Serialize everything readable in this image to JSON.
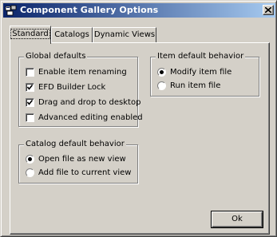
{
  "window": {
    "title": "Component Gallery Options",
    "close_label": "×"
  },
  "tabs": [
    {
      "label": "Standard",
      "active": true
    },
    {
      "label": "Catalogs",
      "active": false
    },
    {
      "label": "Dynamic Views",
      "active": false
    }
  ],
  "global_defaults": {
    "title": "Global defaults",
    "options": [
      {
        "label": "Enable item renaming",
        "checked": false
      },
      {
        "label": "EFD Builder Lock",
        "checked": true
      },
      {
        "label": "Drag and drop to desktop",
        "checked": true
      },
      {
        "label": "Advanced editing enabled",
        "checked": false
      }
    ]
  },
  "item_default_behavior": {
    "title": "Item default behavior",
    "options": [
      {
        "label": "Modify item file",
        "selected": true
      },
      {
        "label": "Run item file",
        "selected": false
      }
    ]
  },
  "catalog_default_behavior": {
    "title": "Catalog default behavior",
    "options": [
      {
        "label": "Open file as new view",
        "selected": true
      },
      {
        "label": "Add file to current view",
        "selected": false
      }
    ]
  },
  "buttons": {
    "ok_label": "Ok"
  }
}
